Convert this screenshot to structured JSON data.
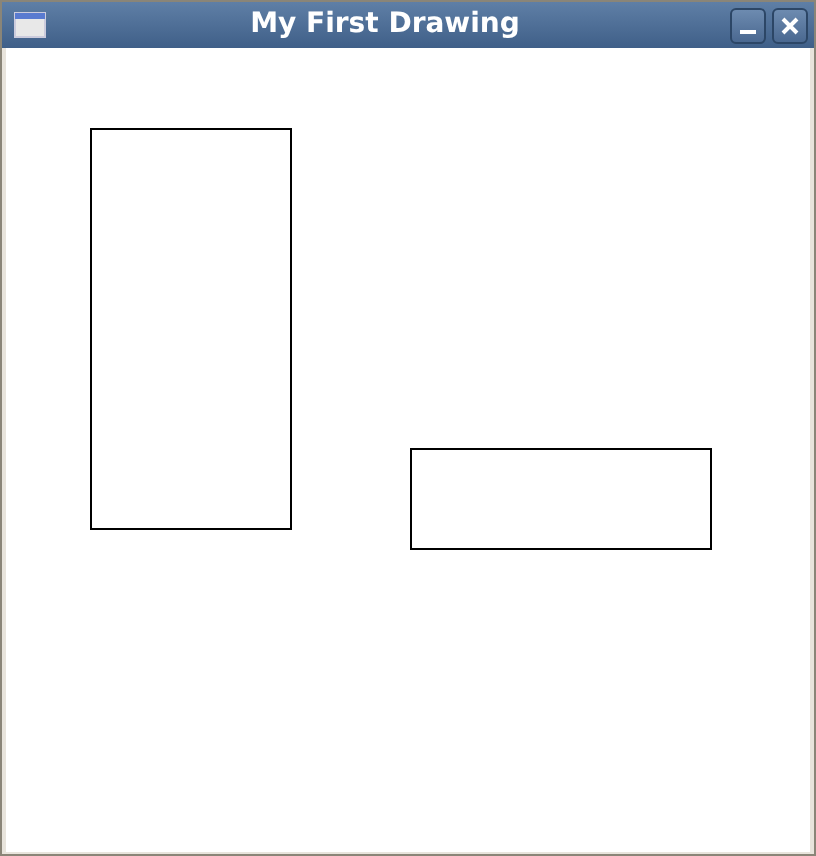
{
  "window": {
    "title": "My First Drawing"
  },
  "shapes": [
    {
      "kind": "rectangle"
    },
    {
      "kind": "rectangle"
    }
  ]
}
